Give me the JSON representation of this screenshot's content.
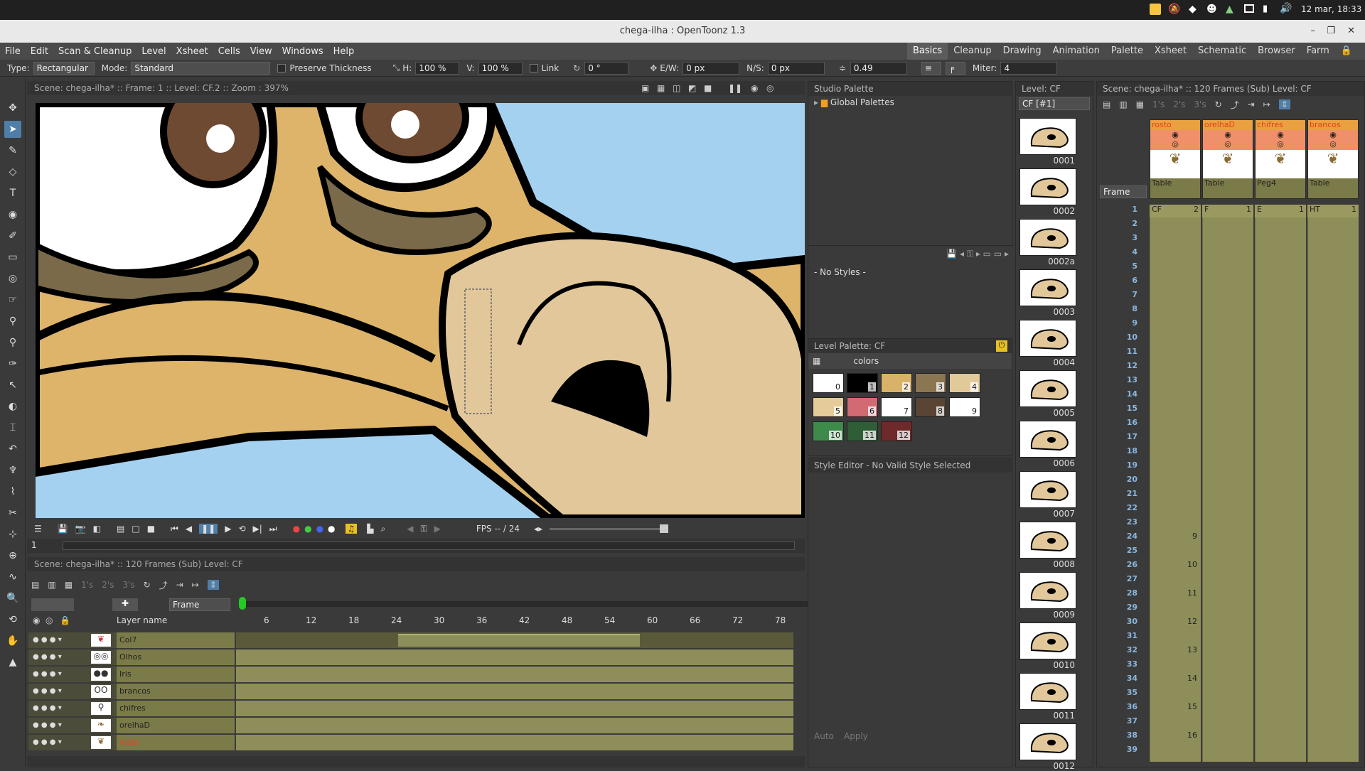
{
  "system": {
    "clock": "12 mar, 18:33"
  },
  "window": {
    "title": "chega-ilha : OpenToonz 1.3"
  },
  "menu": [
    "File",
    "Edit",
    "Scan & Cleanup",
    "Level",
    "Xsheet",
    "Cells",
    "View",
    "Windows",
    "Help"
  ],
  "rooms": [
    "Basics",
    "Cleanup",
    "Drawing",
    "Animation",
    "Palette",
    "Xsheet",
    "Schematic",
    "Browser",
    "Farm"
  ],
  "active_room": "Basics",
  "tool_options": {
    "type_label": "Type:",
    "type_value": "Rectangular",
    "mode_label": "Mode:",
    "mode_value": "Standard",
    "preserve_thickness": "Preserve Thickness",
    "h_label": "H:",
    "h_value": "100 %",
    "v_label": "V:",
    "v_value": "100 %",
    "link": "Link",
    "rotation": "0 °",
    "ew_label": "E/W:",
    "ew_value": "0 px",
    "ns_label": "N/S:",
    "ns_value": "0 px",
    "thickness": "0.49",
    "miter_label": "Miter:",
    "miter_value": "4"
  },
  "viewer": {
    "header": "Scene: chega-ilha*  ::  Frame: 1  ::  Level: CF.2  ::  Zoom : 397%",
    "frame_field": "1",
    "fps_label": "FPS -- / 24"
  },
  "xsheet_bottom": {
    "header": "Scene: chega-ilha*  ::  120 Frames (Sub)  Level: CF",
    "frame_mode": "Frame",
    "layer_name_header": "Layer name",
    "ruler": [
      "6",
      "12",
      "18",
      "24",
      "30",
      "36",
      "42",
      "48",
      "54",
      "60",
      "66",
      "72",
      "78"
    ],
    "layers": [
      {
        "name": "Col7"
      },
      {
        "name": "Olhos"
      },
      {
        "name": "Iris"
      },
      {
        "name": "brancos"
      },
      {
        "name": "chifres"
      },
      {
        "name": "orelhaD"
      },
      {
        "name": "rosto"
      }
    ],
    "step_buttons": [
      "1's",
      "2's",
      "3's"
    ]
  },
  "studio_palette": {
    "header": "Studio Palette",
    "item": "Global Palettes",
    "no_styles": "- No Styles -"
  },
  "level_palette": {
    "header": "Level Palette: CF",
    "tab": "colors",
    "swatches": [
      {
        "n": "0",
        "c": "#ffffff"
      },
      {
        "n": "1",
        "c": "#000000"
      },
      {
        "n": "2",
        "c": "#d9b26a"
      },
      {
        "n": "3",
        "c": "#8a7650"
      },
      {
        "n": "4",
        "c": "#e2c99a"
      },
      {
        "n": "5",
        "c": "#e6cb9a"
      },
      {
        "n": "6",
        "c": "#d16a72"
      },
      {
        "n": "7",
        "c": "#ffffff"
      },
      {
        "n": "8",
        "c": "#5a4434"
      },
      {
        "n": "9",
        "c": "#ffffff"
      },
      {
        "n": "10",
        "c": "#3d8a4a"
      },
      {
        "n": "11",
        "c": "#2f5e36"
      },
      {
        "n": "12",
        "c": "#6e2a2a"
      }
    ]
  },
  "style_editor": {
    "header": "Style Editor - No Valid Style Selected",
    "auto": "Auto",
    "apply": "Apply"
  },
  "level_strip": {
    "header": "Level:  CF",
    "selector": "CF  [#1]",
    "frames": [
      "0001",
      "0002",
      "0002a",
      "0003",
      "0004",
      "0005",
      "0006",
      "0007",
      "0008",
      "0009",
      "0010",
      "0011",
      "0012"
    ]
  },
  "xsheet_right": {
    "header": "Scene: chega-ilha*  ::  120 Frames (Sub)  Level: CF",
    "frame_mode": "Frame",
    "columns": [
      {
        "name": "rosto",
        "peg": "Table",
        "cell": "CF",
        "num": "2"
      },
      {
        "name": "orelhaD",
        "peg": "Table",
        "cell": "F",
        "num": "1"
      },
      {
        "name": "chifres",
        "peg": "Peg4",
        "peg2": "B",
        "cell": "E",
        "num": "1"
      },
      {
        "name": "brancos",
        "peg": "Table",
        "cell": "HT",
        "num": "1"
      }
    ],
    "frames": [
      "1",
      "2",
      "3",
      "4",
      "5",
      "6",
      "7",
      "8",
      "9",
      "10",
      "11",
      "12",
      "13",
      "14",
      "15",
      "16",
      "17",
      "18",
      "19",
      "20",
      "21",
      "22",
      "23",
      "24",
      "25",
      "26",
      "27",
      "28",
      "29",
      "30",
      "31",
      "32",
      "33",
      "34",
      "35",
      "36",
      "37",
      "38",
      "39"
    ],
    "cell_numbers": [
      {
        "frame": 24,
        "v": "9"
      },
      {
        "frame": 26,
        "v": "10"
      },
      {
        "frame": 28,
        "v": "11"
      },
      {
        "frame": 30,
        "v": "12"
      },
      {
        "frame": 32,
        "v": "13"
      },
      {
        "frame": 34,
        "v": "14"
      },
      {
        "frame": 36,
        "v": "15"
      },
      {
        "frame": 38,
        "v": "16"
      }
    ]
  }
}
